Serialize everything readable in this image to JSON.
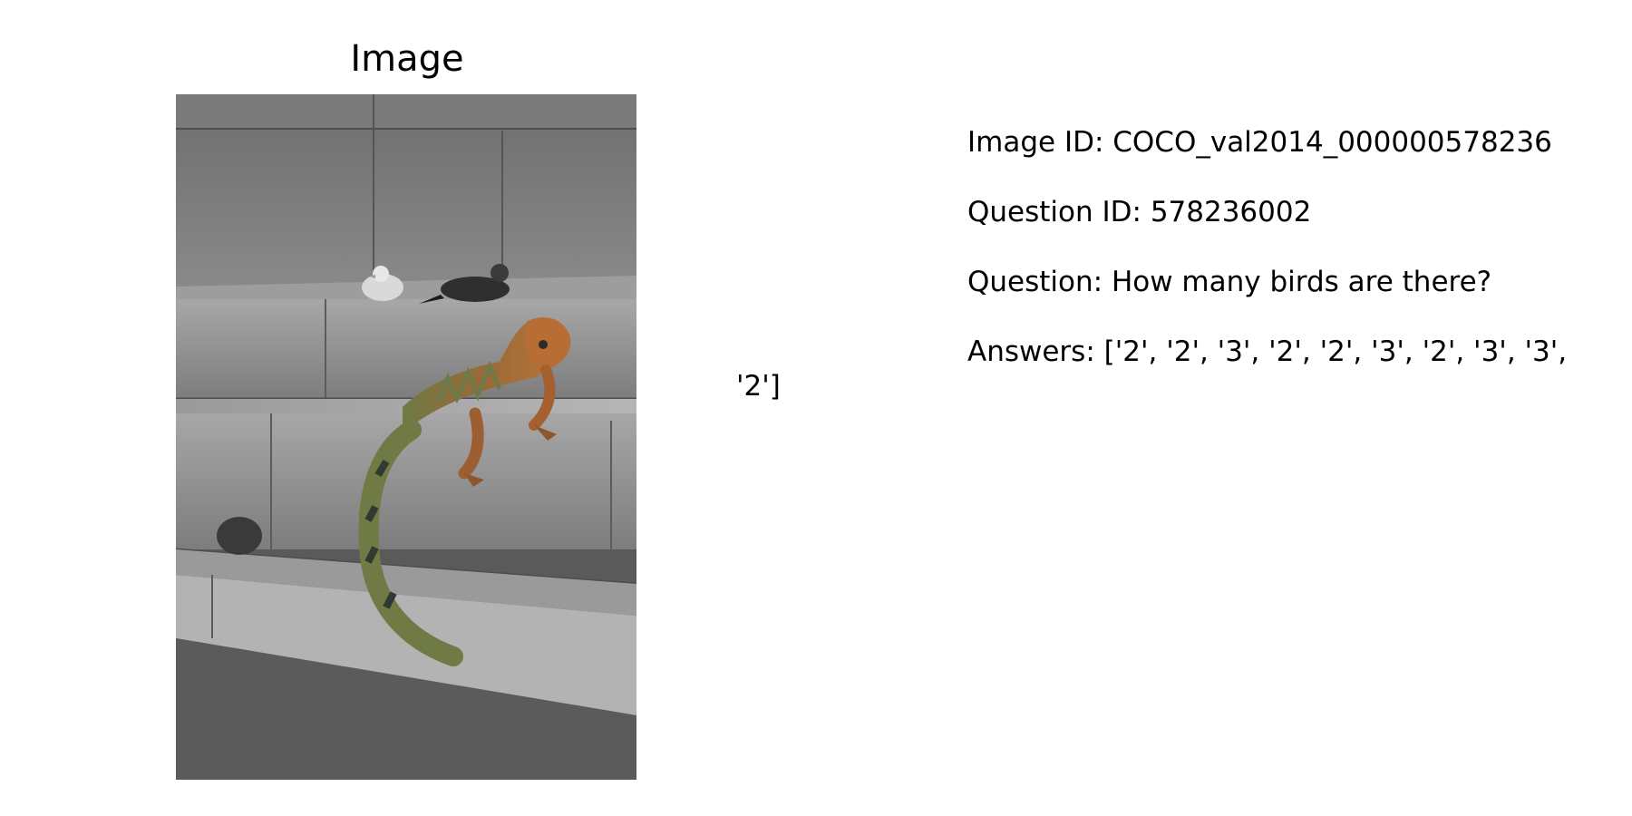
{
  "panel": {
    "title": "Image"
  },
  "photo": {
    "subject": "iguana on stone steps with two pigeons and a coconut",
    "palette": {
      "stone_light": "#b9b9b9",
      "stone_mid": "#8e8e8e",
      "stone_dark": "#4a4a4a",
      "iguana_orange": "#b8733a",
      "iguana_green": "#6f7a45",
      "iguana_dark": "#2f3a33"
    }
  },
  "info": {
    "image_id_text": "Image ID: COCO_val2014_000000578236",
    "question_id_text": "Question ID: 578236002",
    "question_text": "Question: How many birds are there?",
    "answers_text_line1": "Answers: ['2', '2', '3', '2', '2', '3', '2', '3', '3',",
    "answers_text_line2": "'2']"
  }
}
